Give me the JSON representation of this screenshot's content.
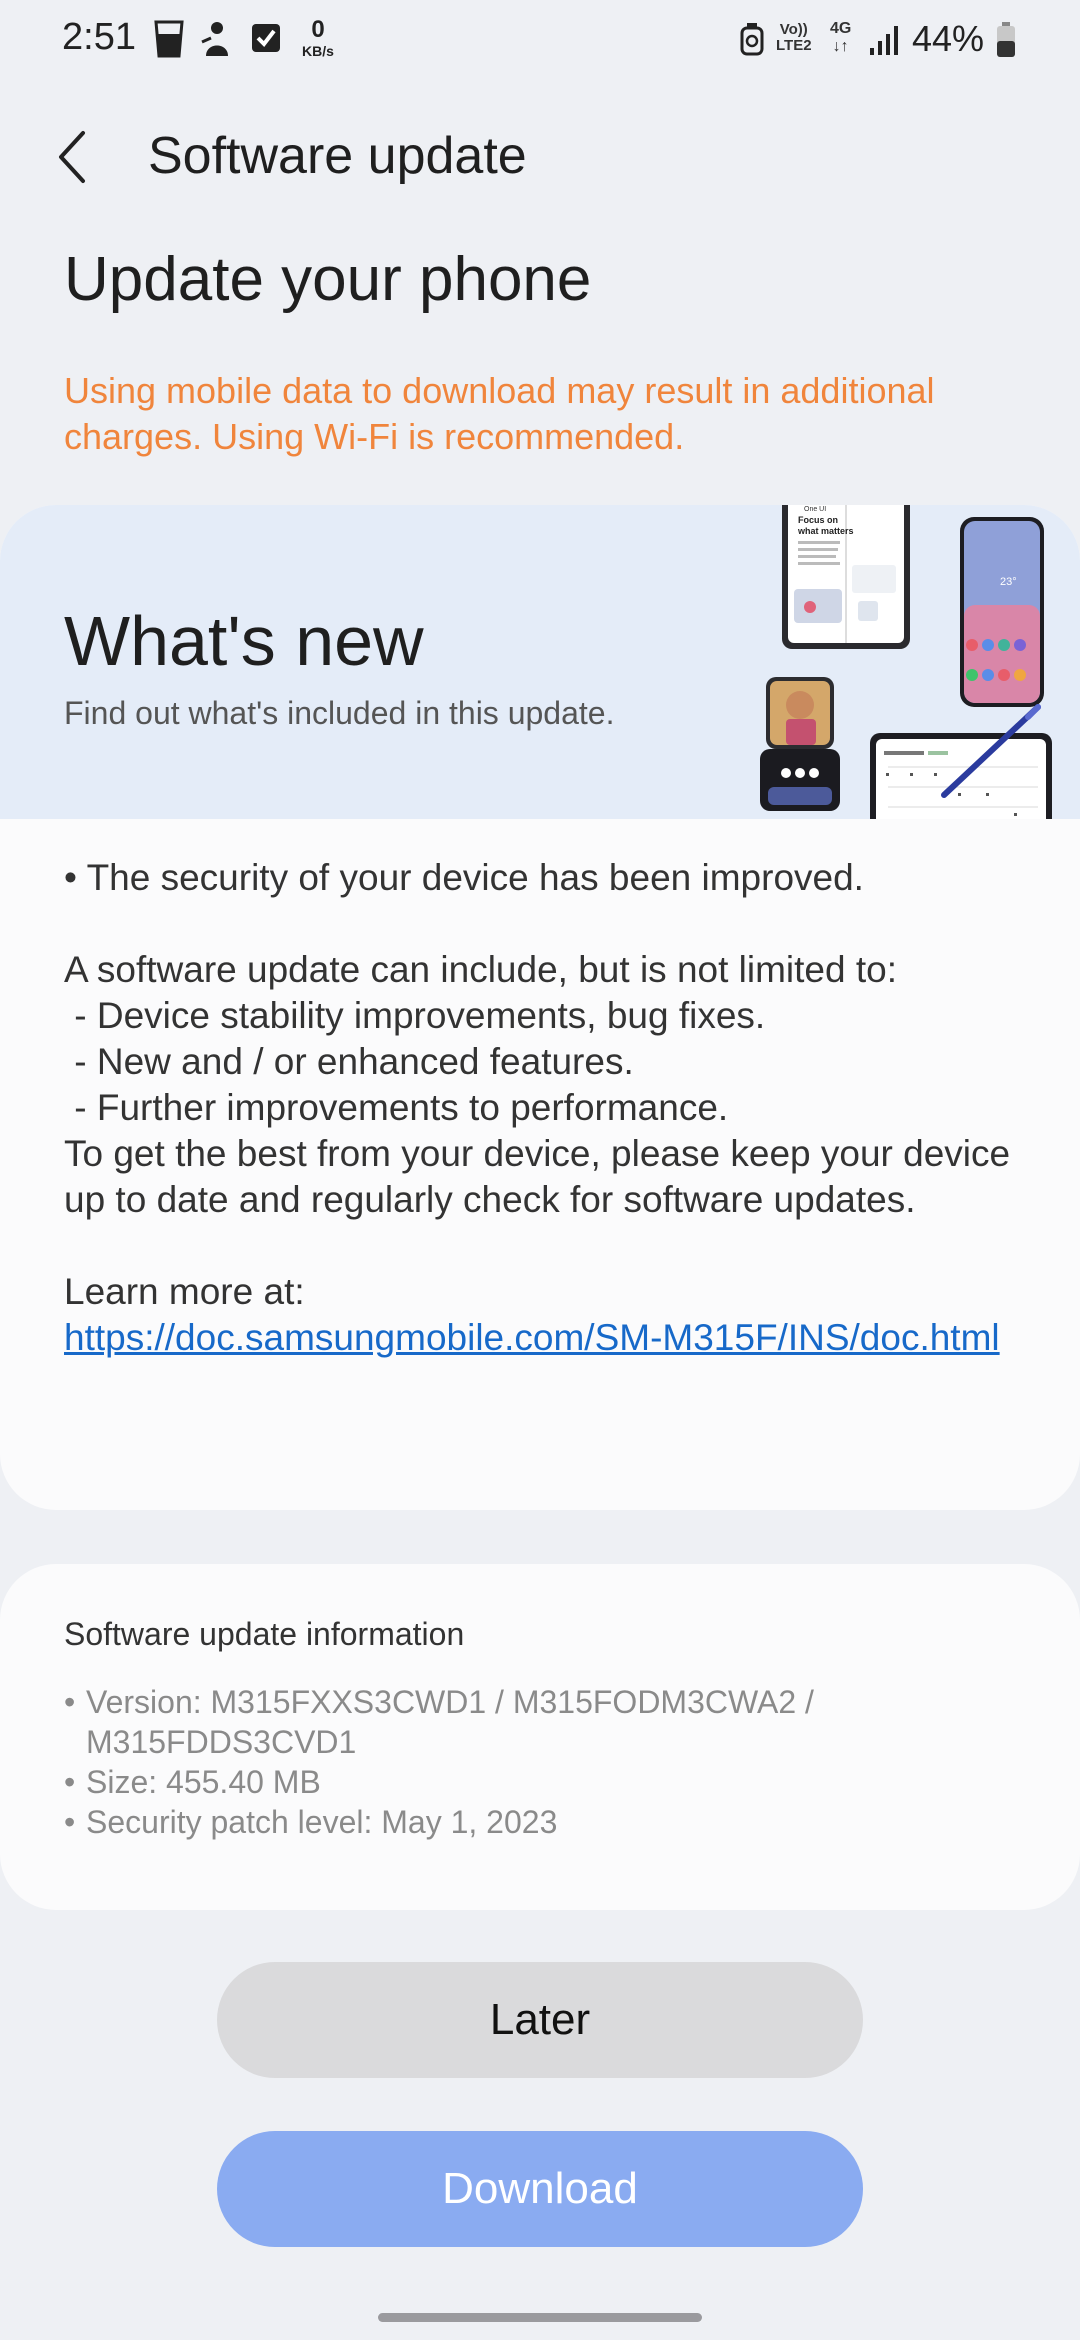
{
  "status_bar": {
    "time": "2:51",
    "netspeed_value": "0",
    "netspeed_unit": "KB/s",
    "volte_line1": "Vo))",
    "volte_line2": "LTE2",
    "network": "4G",
    "battery": "44%",
    "icons": [
      "glass-icon",
      "person-icon",
      "checkbox-icon",
      "alarm-icon",
      "signal-icon",
      "battery-icon"
    ]
  },
  "header": {
    "title": "Software update"
  },
  "page": {
    "title": "Update your phone",
    "warning": "Using mobile data to download may result in additional charges. Using Wi-Fi is recommended.",
    "warning_color": "#f0853c"
  },
  "whats_new": {
    "title": "What's new",
    "subtitle": "Find out what's included in this update.",
    "illustration_text": [
      "One UI",
      "Focus on",
      "what matters",
      "23°"
    ],
    "notes": {
      "bullet": "• The security of your device has been improved.",
      "intro": "A software update can include, but is not limited to:",
      "item1": " - Device stability improvements, bug fixes.",
      "item2": " - New and / or enhanced features.",
      "item3": " - Further improvements to performance.",
      "advice": "To get the best from your device, please keep your device up to date and regularly check for software updates.",
      "learn_more": "Learn more at:",
      "link": "https://doc.samsungmobile.com/SM-M315F/INS/doc.html"
    },
    "link_color": "#1769c9"
  },
  "info": {
    "title": "Software update information",
    "version": "Version: M315FXXS3CWD1 / M315FODM3CWA2 / M315FDDS3CVD1",
    "size": "Size: 455.40 MB",
    "patch": "Security patch level: May 1, 2023"
  },
  "buttons": {
    "later": "Later",
    "download": "Download",
    "download_color": "#8aabf1"
  }
}
